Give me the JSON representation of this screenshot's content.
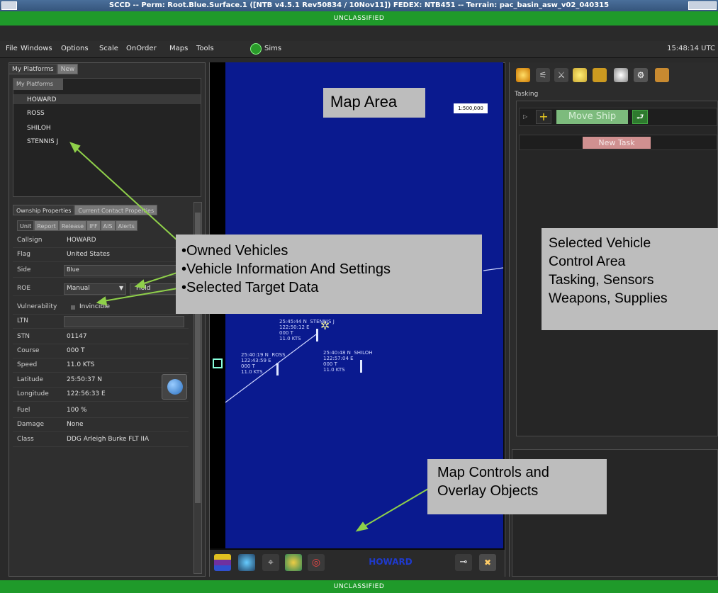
{
  "window": {
    "title": "SCCD -- Perm: Root.Blue.Surface.1 ([NTB v4.5.1 Rev50834 / 10Nov11]) FEDEX: NTB451 -- Terrain: pac_basin_asw_v02_040315"
  },
  "classification": {
    "top": "UNCLASSIFIED",
    "bottom": "UNCLASSIFIED"
  },
  "menu": {
    "items": [
      "File",
      "Windows",
      "Options",
      "Scale",
      "OnOrder",
      "Maps",
      "Tools",
      "Sims"
    ],
    "clock": "15:48:14 UTC"
  },
  "platforms": {
    "tabs": [
      "My Platforms",
      "New"
    ],
    "header": "My Platforms",
    "items": [
      "HOWARD",
      "ROSS",
      "SHILOH",
      "STENNIS J"
    ]
  },
  "properties": {
    "tabs": [
      "Ownship Properties",
      "Current Contact Properties"
    ],
    "subtabs": [
      "Unit",
      "Report",
      "Release",
      "IFF",
      "AIS",
      "Alerts"
    ],
    "rows": [
      {
        "label": "Callsign",
        "value": "HOWARD"
      },
      {
        "label": "Flag",
        "value": "United States"
      },
      {
        "label": "Side",
        "value": "Blue"
      },
      {
        "label": "ROE",
        "value": "Manual",
        "extra": "Hold"
      },
      {
        "label": "Vulnerability",
        "value": "Invincible"
      },
      {
        "label": "LTN",
        "value": ""
      },
      {
        "label": "STN",
        "value": "01147"
      },
      {
        "label": "Course",
        "value": "000 T"
      },
      {
        "label": "Speed",
        "value": "11.0 KTS"
      },
      {
        "label": "Latitude",
        "value": "25:50:37 N"
      },
      {
        "label": "Longitude",
        "value": "122:56:33 E"
      },
      {
        "label": "Fuel",
        "value": "100 %"
      },
      {
        "label": "Damage",
        "value": "None"
      },
      {
        "label": "Class",
        "value": "DDG Arleigh Burke FLT IIA"
      }
    ]
  },
  "map": {
    "scale": "1:500,000",
    "platform_name": "HOWARD",
    "vehicles": [
      {
        "label": "25:45:44 N  STENNIS J\n122:50:12 E\n000 T\n11.0 KTS"
      },
      {
        "label": "25:40:19 N  ROSS\n122:43:59 E\n000 T\n11.0 KTS"
      },
      {
        "label": "25:40:48 N  SHILOH\n122:57:04 E\n000 T\n11.0 KTS"
      }
    ]
  },
  "tasking": {
    "label": "Tasking",
    "move_ship": "Move Ship",
    "new_task": "New Task"
  },
  "annotations": {
    "map_area": "Map Area",
    "owned": [
      "•Owned Vehicles",
      "•Vehicle Information And Settings",
      "•Selected Target Data"
    ],
    "control": [
      "Selected Vehicle",
      "Control Area",
      "Tasking, Sensors",
      "Weapons, Supplies"
    ],
    "map_controls": [
      "Map Controls and",
      "Overlay Objects"
    ]
  },
  "colors": {
    "classification_green": "#1f9a2a",
    "map_blue": "#0a1a8f",
    "move_ship_green": "#7dbb7d",
    "new_task_pink": "#d09090",
    "callout_gray": "#bdbdbd",
    "arrow_green": "#8fd04a"
  }
}
